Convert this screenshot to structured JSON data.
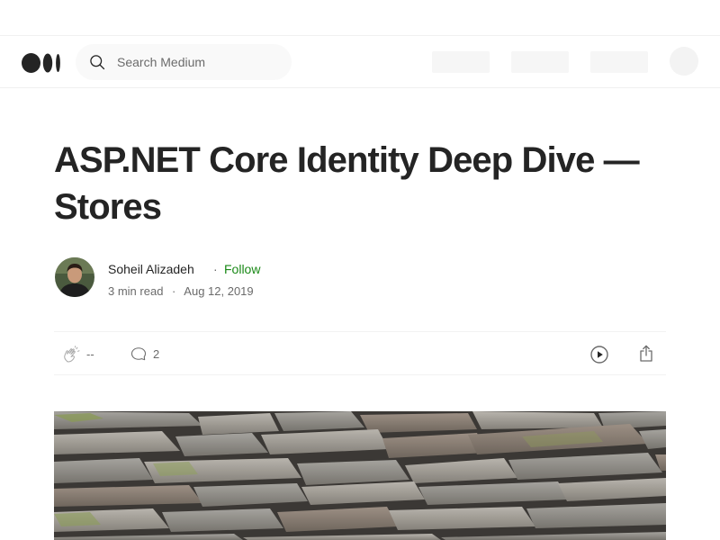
{
  "search": {
    "placeholder": "Search Medium"
  },
  "article": {
    "title": "ASP.NET Core Identity Deep Dive — Stores",
    "author": "Soheil Alizadeh",
    "follow_label": "Follow",
    "separator": "·",
    "read_time": "3 min read",
    "date": "Aug 12, 2019"
  },
  "actions": {
    "claps": "--",
    "responses": "2"
  },
  "colors": {
    "text": "#242424",
    "muted": "#6b6b6b",
    "follow": "#1a8917"
  },
  "icons": [
    "medium-logo",
    "search-icon",
    "clap-icon",
    "response-icon",
    "play-icon",
    "share-icon"
  ]
}
